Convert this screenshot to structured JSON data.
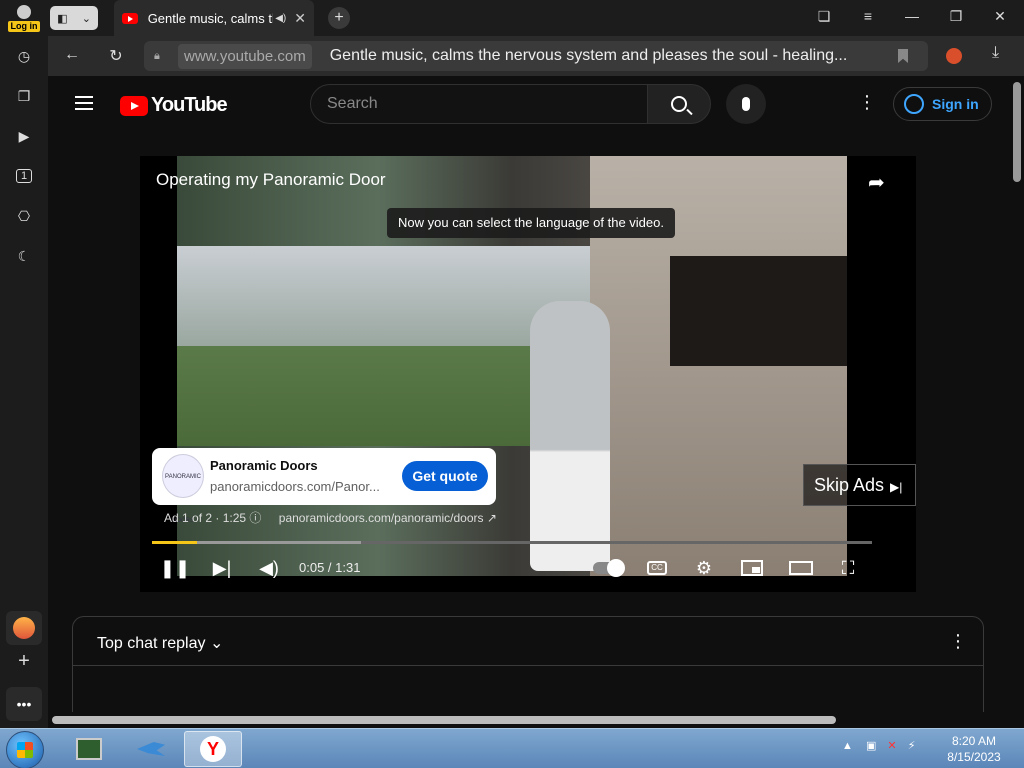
{
  "browser": {
    "login_label": "Log in",
    "tab": {
      "title": "Gentle music, calms the nervous system",
      "audio_icon": "speaker-icon"
    },
    "new_tab": "+",
    "window_controls": [
      "bookmarks-icon",
      "menu-icon",
      "minimize-icon",
      "restore-icon",
      "close-icon"
    ],
    "address": {
      "domain": "www.youtube.com",
      "page_title": "Gentle music, calms the nervous system and pleases the soul - healing..."
    },
    "sidebar_icons": [
      "history-icon",
      "collections-icon",
      "video-icon",
      "one-icon",
      "screenshot-icon",
      "night-mode-icon"
    ]
  },
  "youtube": {
    "logo_text": "YouTube",
    "search": {
      "placeholder": "Search"
    },
    "sign_in": "Sign in",
    "player": {
      "video_title": "Operating my Panoramic Door",
      "tooltip": "Now you can select the language of the video.",
      "ad": {
        "advertiser": "Panoramic Doors",
        "logo_text": "PANORAMIC DOORS",
        "url_short": "panoramicdoors.com/Panor...",
        "cta": "Get quote",
        "info": "Ad 1 of 2 · 1:25",
        "info_icon": "info-icon",
        "link": "panoramicdoors.com/panoramic/doors"
      },
      "skip": "Skip Ads",
      "time": "0:05 / 1:31",
      "progress": 0.063,
      "buffered": 0.29,
      "accent_color": "#f5c518"
    },
    "chat": {
      "title": "Top chat replay"
    }
  },
  "taskbar": {
    "clock_time": "8:20 AM",
    "clock_date": "8/15/2023"
  }
}
